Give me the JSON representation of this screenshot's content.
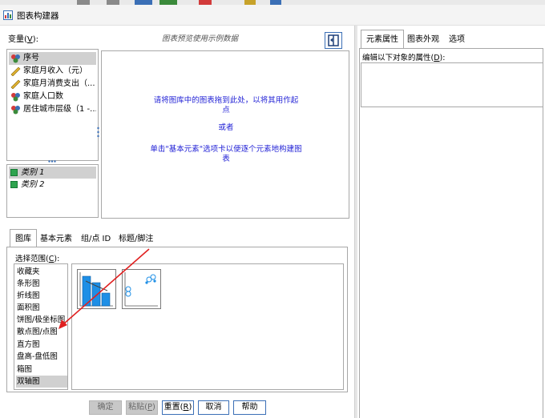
{
  "window": {
    "title": "图表构建器"
  },
  "variables": {
    "label": "变量(",
    "label_key": "V",
    "label_end": "):",
    "items": [
      {
        "name": "序号",
        "icon": "nominal-icon",
        "selected": true
      },
      {
        "name": "家庭月收入（元）",
        "icon": "scale-icon",
        "selected": false
      },
      {
        "name": "家庭月消费支出（...",
        "icon": "scale-icon",
        "selected": false
      },
      {
        "name": "家庭人口数",
        "icon": "nominal-icon",
        "selected": false
      },
      {
        "name": "居住城市层级（1 -...",
        "icon": "nominal-icon",
        "selected": false
      }
    ]
  },
  "categories": {
    "items": [
      {
        "name": "类别 1",
        "selected": true
      },
      {
        "name": "类别 2",
        "selected": false
      }
    ]
  },
  "canvas": {
    "preview_note": "图表预览使用示例数据",
    "messages": [
      "请将图库中的图表拖到此处，以将其用作起",
      "点",
      "或者",
      "单击\"基本元素\"选项卡以便逐个元素地构建图",
      "表"
    ]
  },
  "bottom_tabs": [
    "图库",
    "基本元素",
    "组/点 ID",
    "标题/脚注"
  ],
  "gallery": {
    "choose_label": "选择范围(",
    "choose_key": "C",
    "choose_end": "):",
    "types": [
      "收藏夹",
      "条形图",
      "折线图",
      "面积图",
      "饼图/极坐标图",
      "散点图/点图",
      "直方图",
      "盘高-盘低图",
      "箱图",
      "双轴图"
    ],
    "selected_type": "双轴图"
  },
  "buttons": {
    "ok": "确定",
    "paste": "粘贴(",
    "paste_key": "P",
    "paste_end": ")",
    "reset": "重置(",
    "reset_key": "R",
    "reset_end": ")",
    "cancel": "取消",
    "help": "帮助"
  },
  "right_panel": {
    "tabs": [
      "元素属性",
      "图表外观",
      "选项"
    ],
    "edit_label": "编辑以下对象的属性(",
    "edit_key": "D",
    "edit_end": "):"
  },
  "colors": {
    "accent": "#2323d6",
    "bar_blue": "#1e8fe6",
    "arrow_red": "#e02020",
    "category_green": "#2ea44f"
  }
}
